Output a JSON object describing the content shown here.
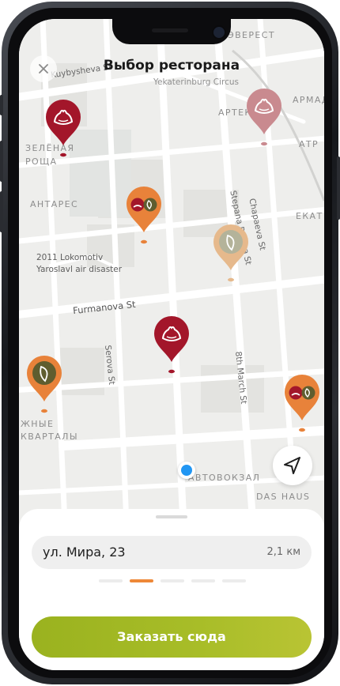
{
  "header": {
    "title": "Выбор ресторана",
    "close_icon": "close-icon"
  },
  "map": {
    "labels": {
      "everest": "ЭВЕРЕСТ",
      "kuybysheva": "Kuybysheva St",
      "circus": "Yekaterinburg Circus",
      "artek": "АРТЕК",
      "armada": "АРМАДА",
      "zelenaya1": "ЗЕЛЁНАЯ",
      "zelenaya2": "РОЩА",
      "antares": "АНТАРЕС",
      "chapaeva": "Chapaeva St",
      "ekat": "ЕКАТ",
      "stepana": "Stepana Razina St",
      "memorial1": "2011 Lokomotiv",
      "memorial2": "Yaroslavl air disaster",
      "furmanova": "Furmanova St",
      "serova": "Serova St",
      "march": "8th March St",
      "kvartaly1": "ЖНЫЕ",
      "kvartaly2": "КВАРТАЛЫ",
      "avtovokzal": "АВТОВОКЗАЛ",
      "dashaus": "DAS HAUS",
      "atr": "АТР"
    },
    "pins": [
      {
        "name": "restaurant-pin-dumpling",
        "brand": "dumpling",
        "color": "#a3162a"
      },
      {
        "name": "restaurant-pin-dumpling-faded",
        "brand": "dumpling",
        "color": "#c98a8f"
      },
      {
        "name": "restaurant-pin-combo",
        "brand": "combo",
        "color": "#e8823a"
      },
      {
        "name": "restaurant-pin-olive-faded",
        "brand": "olive",
        "color": "#e6b98c"
      },
      {
        "name": "restaurant-pin-dumpling-center",
        "brand": "dumpling",
        "color": "#a3162a"
      },
      {
        "name": "restaurant-pin-olive",
        "brand": "olive",
        "color": "#e8823a"
      },
      {
        "name": "restaurant-pin-combo-right",
        "brand": "combo",
        "color": "#e8823a"
      }
    ],
    "locate_icon": "navigation-arrow-icon"
  },
  "sheet": {
    "address": "ул. Мира, 23",
    "distance": "2,1 км",
    "pager": {
      "total": 5,
      "active": 1
    },
    "order_button": "Заказать сюда"
  },
  "colors": {
    "accent_orange": "#ee8838",
    "brand_red": "#a3162a",
    "order_green": "#a3b925",
    "user_location_blue": "#2196f3"
  }
}
